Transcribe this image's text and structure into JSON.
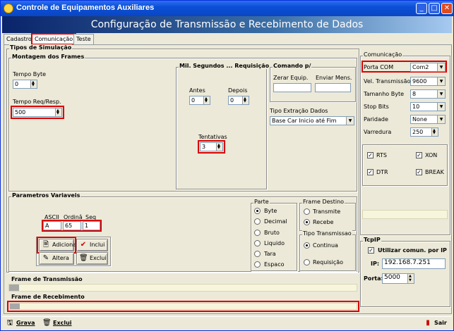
{
  "window": {
    "title": "Controle de Equipamentos Auxiliares",
    "banner": "Configuração de Transmissão e Recebimento de Dados"
  },
  "tabs": [
    "Cadastro",
    "Comunicação",
    "Teste"
  ],
  "sim": {
    "legend": "Tipos de Simulação",
    "frames": {
      "legend": "Montagem dos Frames",
      "tempo_byte_label": "Tempo Byte",
      "tempo_byte": "0",
      "tempo_req_label": "Tempo Req/Resp.",
      "tempo_req": "500"
    },
    "mil": {
      "legend": "Mil. Segundos ... Requisição",
      "antes_label": "Antes",
      "antes": "0",
      "depois_label": "Depois",
      "depois": "0",
      "tentativas_label": "Tentativas",
      "tentativas": "3"
    },
    "comando": {
      "legend": "Comando p/",
      "zerar_label": "Zerar Equip.",
      "enviar_label": "Enviar Mens.",
      "tipo_label": "Tipo Extração Dados",
      "tipo": "Base Car Inicio até Fim"
    },
    "params": {
      "legend": "Parametros Variaveis",
      "ascii_label": "ASCII",
      "ordina_label": "Ordinâ",
      "seq_label": "Seq",
      "ascii": "A",
      "ordina": "65",
      "seq": "1",
      "adiciona": "Adiciona",
      "inclui": "Inclui",
      "altera": "Altera",
      "exclui": "Exclui",
      "parte": {
        "legend": "Parte",
        "options": [
          "Byte",
          "Decimal",
          "Bruto",
          "Liquido",
          "Tara",
          "Espaco"
        ]
      },
      "frame_destino": {
        "legend": "Frame Destino",
        "options": [
          "Transmite",
          "Recebe"
        ]
      },
      "tipo_trans": {
        "legend": "Tipo Transmissao",
        "options": [
          "Continua",
          "Requisição"
        ]
      }
    }
  },
  "comm": {
    "legend": "Comunicação",
    "porta_label": "Porta COM",
    "porta": "Com2",
    "vel_label": "Vel. Transmissão",
    "vel": "9600",
    "tam_label": "Tamanho Byte",
    "tam": "8",
    "stop_label": "Stop Bits",
    "stop": "10",
    "par_label": "Paridade",
    "par": "None",
    "var_label": "Varredura",
    "var": "250",
    "rts": "RTS",
    "xon": "XON",
    "dtr": "DTR",
    "brk": "BREAK"
  },
  "tcp": {
    "legend": "TcpIP",
    "use_label": "Utilizar comun. por IP",
    "ip_label": "IP:",
    "ip": "192.168.7.251",
    "porta_label": "Porta:",
    "porta": "5000"
  },
  "frame_tx_label": "Frame de Transmissão",
  "frame_rx_label": "Frame de Recebimento",
  "footer": {
    "grava": "Grava",
    "exclui": "Exclui",
    "sair": "Sair"
  }
}
